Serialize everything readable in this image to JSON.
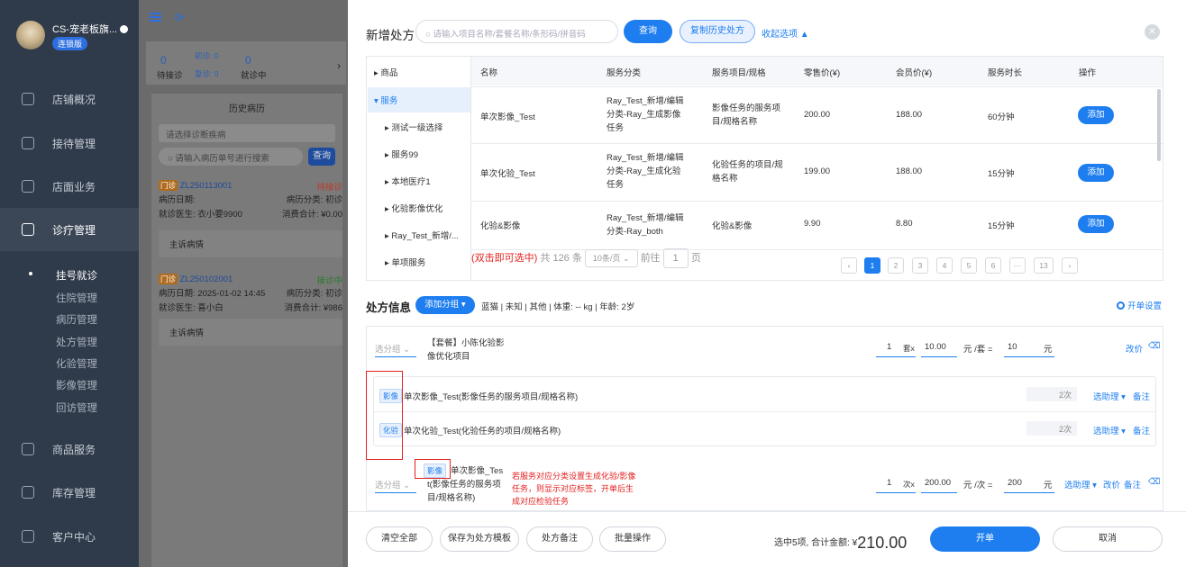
{
  "sidebar": {
    "shop_name": "CS-宠老板旗...",
    "badge": "连锁版",
    "nav": [
      {
        "label": "店铺概况",
        "icon": "dashboard-icon"
      },
      {
        "label": "接待管理",
        "icon": "reception-icon"
      },
      {
        "label": "店面业务",
        "icon": "store-icon"
      },
      {
        "label": "诊疗管理",
        "icon": "medical-icon"
      }
    ],
    "sub": [
      "挂号就诊",
      "住院管理",
      "病历管理",
      "处方管理",
      "化验管理",
      "影像管理",
      "回访管理"
    ],
    "nav_bottom": [
      {
        "label": "商品服务",
        "icon": "goods-icon"
      },
      {
        "label": "库存管理",
        "icon": "inventory-icon"
      },
      {
        "label": "客户中心",
        "icon": "customer-icon"
      }
    ]
  },
  "middle": {
    "waiting_count": "0",
    "waiting_label": "待接诊",
    "first_visit": "初诊: 0",
    "return_visit": "复诊: 0",
    "in_visit_count": "0",
    "in_visit_label": "就诊中",
    "history_title": "历史病历",
    "select_placeholder": "请选择诊断疾病",
    "search_placeholder": "请输入病历单号进行搜索",
    "search_btn": "查询",
    "cards": [
      {
        "tag": "门诊",
        "id": "ZL250113001",
        "status": "待接诊",
        "date_label": "病历日期:",
        "date": "",
        "cat": "病历分类: 初诊",
        "doctor": "就诊医生: 衣小要9900",
        "total": "消费合计: ¥0.00",
        "complaint": "主诉病情"
      },
      {
        "tag": "门诊",
        "id": "ZL250102001",
        "status": "接诊中",
        "date_label": "病历日期:",
        "date": "2025-01-02 14:45",
        "cat": "病历分类: 初诊",
        "doctor": "就诊医生: 喜小白",
        "total": "消费合计: ¥986",
        "complaint": "主诉病情"
      }
    ]
  },
  "modal": {
    "title": "新增处方",
    "search_placeholder": "请输入项目名称/套餐名称/条形码/拼音码",
    "query_btn": "查询",
    "copy_btn": "复制历史处方",
    "collapse": "收起选项 ▲",
    "close": "✕",
    "tree": [
      "商品",
      "服务",
      "测试一级选择",
      "服务99",
      "本地医疗1",
      "化验影像优化",
      "Ray_Test_新增/...",
      "单项服务"
    ],
    "columns": [
      "名称",
      "服务分类",
      "服务项目/规格",
      "零售价(¥)",
      "会员价(¥)",
      "服务时长",
      "操作"
    ],
    "rows": [
      {
        "name": "单次影像_Test",
        "cat": [
          "Ray_Test_新增/编辑",
          "分类-Ray_生成影像",
          "任务"
        ],
        "spec": [
          "影像任务的服务项",
          "目/规格名称"
        ],
        "retail": "200.00",
        "member": "188.00",
        "duration": "60分钟",
        "action": "添加"
      },
      {
        "name": "单次化验_Test",
        "cat": [
          "Ray_Test_新增/编辑",
          "分类-Ray_生成化验",
          "任务"
        ],
        "spec": [
          "化验任务的项目/规",
          "格名称"
        ],
        "retail": "199.00",
        "member": "188.00",
        "duration": "15分钟",
        "action": "添加"
      },
      {
        "name": "化验&影像",
        "cat": [
          "Ray_Test_新增/编辑",
          "分类-Ray_both"
        ],
        "spec": [
          "化验&影像"
        ],
        "retail": "9.90",
        "member": "8.80",
        "duration": "15分钟",
        "action": "添加"
      }
    ],
    "hint": "(双击即可选中)",
    "total_items": "共 126 条",
    "page_size": "10条/页",
    "pages": [
      "1",
      "2",
      "3",
      "4",
      "5",
      "6",
      "···",
      "13"
    ],
    "goto_label": "前往",
    "goto_value": "1",
    "page_unit": "页"
  },
  "rx": {
    "title": "处方信息",
    "add_group": "添加分组 ▾",
    "pet": "蓝猫 | 未知 | 其他 | 体重: -- kg | 年龄: 2岁",
    "settings": "开单设置",
    "group_placeholder": "选分组",
    "pkg_name": "【套餐】小陈化验影",
    "pkg_name2": "像优化项目",
    "pkg_qty": "1",
    "pkg_unit": "套x",
    "pkg_price": "10.00",
    "pkg_price_unit": "元 /套 =",
    "pkg_total": "10",
    "yuan": "元",
    "reprice": "改价",
    "delete_icon": "trash-icon",
    "children": [
      {
        "chip": "影像",
        "name": "单次影像_Test(影像任务的服务项目/规格名称)",
        "count": "2次",
        "handler": "选助理 ▾",
        "note": "备注"
      },
      {
        "chip": "化验",
        "name": "单次化验_Test(化验任务的项目/规格名称)",
        "count": "2次",
        "handler": "选助理 ▾",
        "note": "备注"
      }
    ],
    "single_chip": "影像",
    "single_name": [
      "单次影像_Tes",
      "t(影像任务的服务项",
      "目/规格名称)"
    ],
    "single_qty": "1",
    "single_unit": "次x",
    "single_price": "200.00",
    "single_price_unit": "元 /次 =",
    "single_total": "200",
    "note_text": "若服务对应分类设置生成化验/影像任务，则显示对应标签，开单后生成对应检验任务",
    "handler": "选助理 ▾",
    "note": "备注"
  },
  "footer": {
    "clear": "清空全部",
    "save_tpl": "保存为处方模板",
    "rx_note": "处方备注",
    "batch": "批量操作",
    "summary": "选中5项, 合计金额: ¥",
    "amount": "210.00",
    "submit": "开单",
    "cancel": "取消"
  },
  "colors": {
    "accent": "#1e7ef0",
    "sidebar": "#2f3a4a",
    "note_red": "#e32222"
  }
}
